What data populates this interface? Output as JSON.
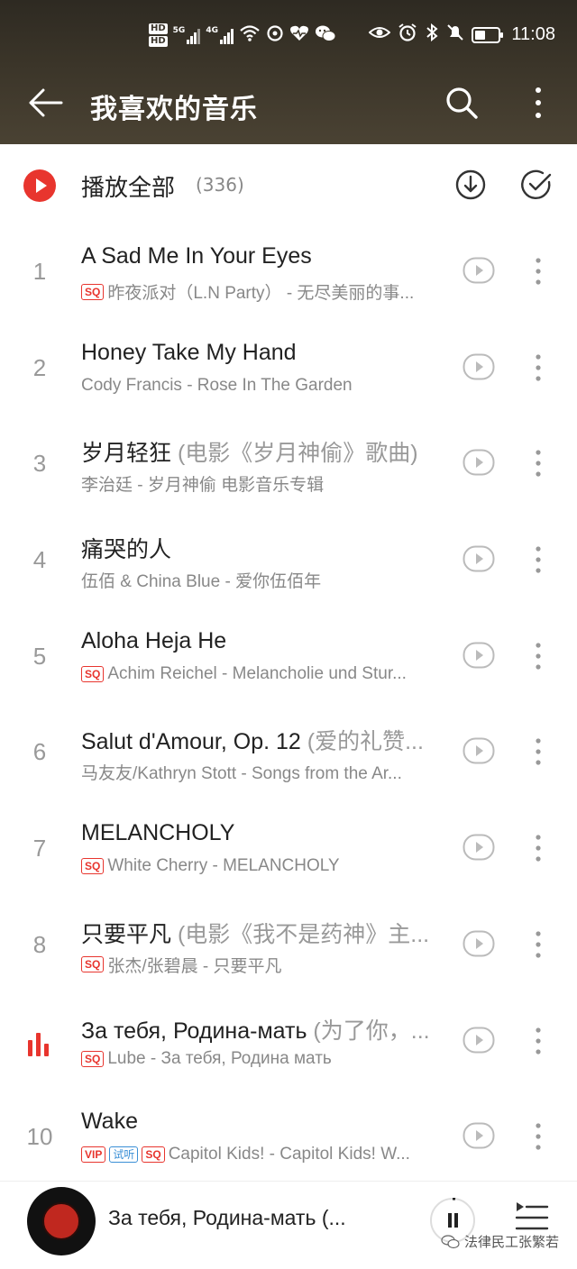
{
  "status": {
    "hd1": "HD",
    "hd2": "HD",
    "sig1_type": "5G",
    "sig2_type": "4G",
    "time": "11:08",
    "battery_level": 0.45
  },
  "header": {
    "title": "我喜欢的音乐"
  },
  "playall": {
    "label": "播放全部",
    "count": "(336)"
  },
  "songs": [
    {
      "num": "1",
      "title": "A Sad Me In Your Eyes",
      "sub": "",
      "tags": [
        "SQ"
      ],
      "meta": "昨夜派对（L.N Party） - 无尽美丽的事..."
    },
    {
      "num": "2",
      "title": "Honey Take My Hand",
      "sub": "",
      "tags": [],
      "meta": "Cody Francis - Rose In The Garden"
    },
    {
      "num": "3",
      "title": "岁月轻狂",
      "sub": " (电影《岁月神偷》歌曲)",
      "tags": [],
      "meta": "李治廷 - 岁月神偷 电影音乐专辑"
    },
    {
      "num": "4",
      "title": "痛哭的人",
      "sub": "",
      "tags": [],
      "meta": "伍佰 & China Blue - 爱你伍佰年"
    },
    {
      "num": "5",
      "title": "Aloha Heja He",
      "sub": "",
      "tags": [
        "SQ"
      ],
      "meta": "Achim Reichel - Melancholie und Stur..."
    },
    {
      "num": "6",
      "title": "Salut d'Amour, Op. 12",
      "sub": " (爱的礼赞...",
      "tags": [],
      "meta": "马友友/Kathryn Stott - Songs from the Ar..."
    },
    {
      "num": "7",
      "title": "MELANCHOLY",
      "sub": "",
      "tags": [
        "SQ"
      ],
      "meta": "White Cherry - MELANCHOLY"
    },
    {
      "num": "8",
      "title": "只要平凡",
      "sub": " (电影《我不是药神》主...",
      "tags": [
        "SQ"
      ],
      "meta": "张杰/张碧晨 - 只要平凡"
    },
    {
      "num": "",
      "playing": true,
      "title": "За тебя, Родина-мать",
      "sub": " (为了你，...",
      "tags": [
        "SQ"
      ],
      "meta": "Lube - За тебя, Родина мать"
    },
    {
      "num": "10",
      "title": "Wake",
      "sub": "",
      "tags": [
        "VIP",
        "试听",
        "SQ"
      ],
      "meta": "Capitol Kids! - Capitol Kids! W..."
    }
  ],
  "mini_player": {
    "title": "За тебя, Родина-мать (...",
    "progress": 0.02
  },
  "watermark": "法律民工张繁若",
  "colors": {
    "accent": "#e8352e",
    "header_bg": "#3b3529"
  }
}
